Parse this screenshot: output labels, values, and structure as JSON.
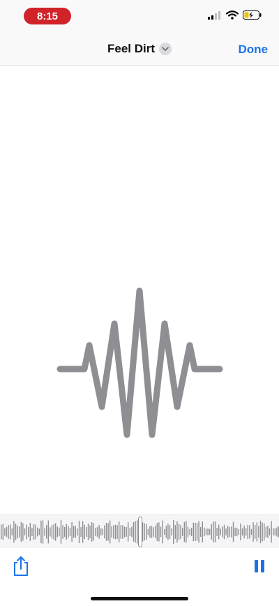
{
  "status_bar": {
    "time": "8:15"
  },
  "nav": {
    "title": "Feel Dirt",
    "done_label": "Done"
  },
  "colors": {
    "accent": "#1a73e8",
    "time_pill": "#d1232a",
    "wave_gray": "#8e8e93"
  },
  "icons": {
    "waveform": "waveform-icon",
    "share": "share-icon",
    "pause": "pause-icon"
  }
}
